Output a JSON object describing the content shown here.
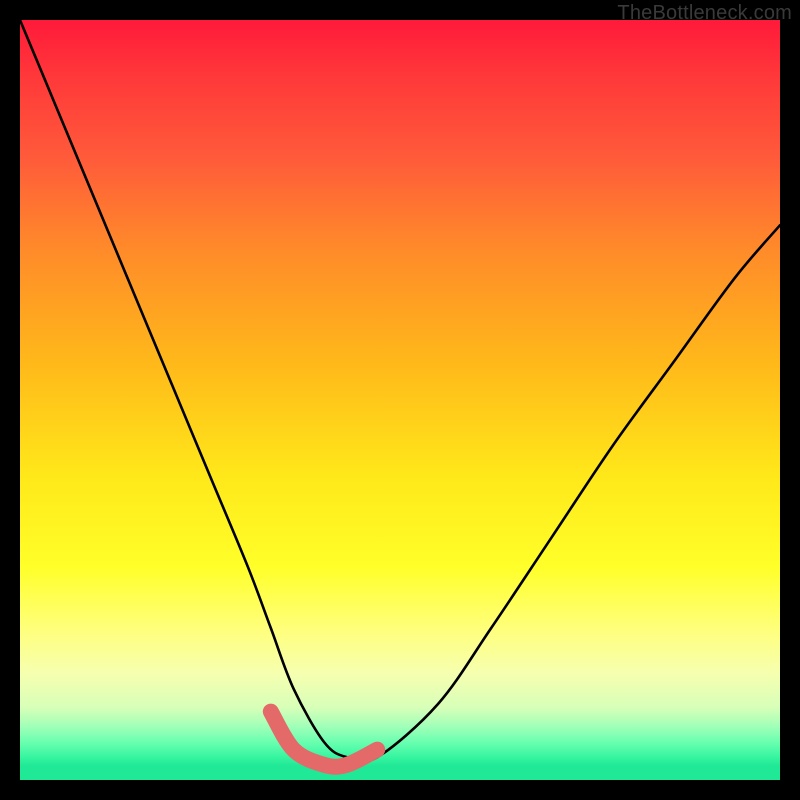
{
  "watermark": "TheBottleneck.com",
  "chart_data": {
    "type": "line",
    "title": "",
    "xlabel": "",
    "ylabel": "",
    "xlim": [
      0,
      100
    ],
    "ylim": [
      0,
      100
    ],
    "series": [
      {
        "name": "black-curve",
        "x": [
          0,
          5,
          10,
          15,
          20,
          25,
          30,
          33,
          36,
          40,
          43,
          47,
          55,
          62,
          70,
          78,
          86,
          94,
          100
        ],
        "values": [
          100,
          88,
          76,
          64,
          52,
          40,
          28,
          20,
          12,
          5,
          3,
          3,
          10,
          20,
          32,
          44,
          55,
          66,
          73
        ]
      },
      {
        "name": "pink-highlight",
        "x": [
          33,
          36,
          40,
          43,
          47
        ],
        "values": [
          9,
          4,
          2,
          2,
          4
        ]
      }
    ],
    "grid": false,
    "legend": false
  },
  "colors": {
    "curve_black": "#000000",
    "highlight_pink": "#e46a6a"
  }
}
